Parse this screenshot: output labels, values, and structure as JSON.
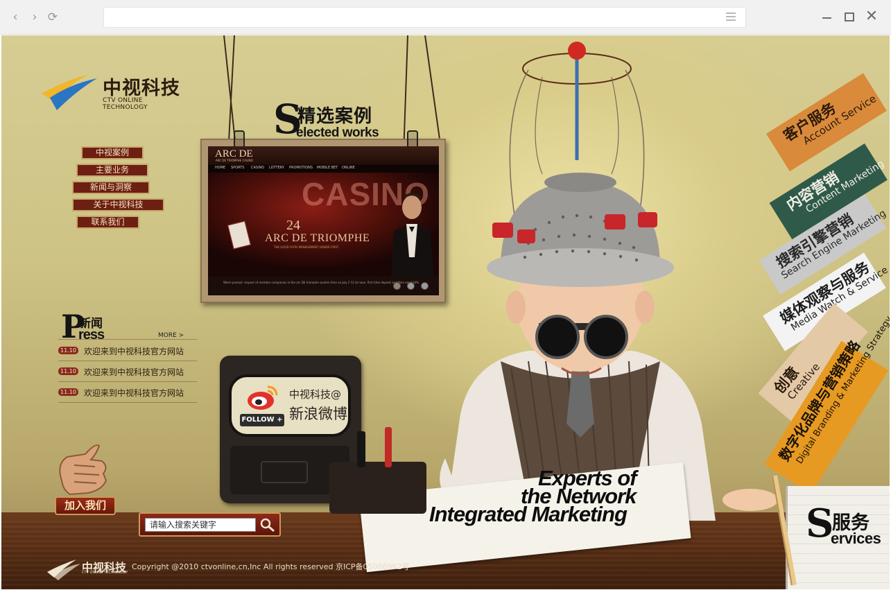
{
  "browser": {
    "back": "‹",
    "forward": "›",
    "reload": "⟳",
    "url": "",
    "close": "✕"
  },
  "logo": {
    "cn": "中视科技",
    "en": "CTV ONLINE TECHNOLOGY"
  },
  "nav": [
    {
      "label": "中视案例"
    },
    {
      "label": "主要业务"
    },
    {
      "label": "新闻与洞察"
    },
    {
      "label": "关于中视科技"
    },
    {
      "label": "联系我们"
    }
  ],
  "selected_works": {
    "initial": "S",
    "cn": "精选案例",
    "en": "elected works",
    "preview": {
      "logo": "ARC DE",
      "logo_sub": "ARC DE TRIOMPHE CASINO",
      "nav": [
        "HOME",
        "SPORTS",
        "CASINO",
        "LOTTERY",
        "PROMOTIONS",
        "MOBILE BET",
        "ONLINE"
      ],
      "banner_word": "CASINO",
      "number": "24",
      "headline": "ARC DE TRIOMPHE",
      "tagline": "THE GOOD FAITH MANAGEMENT HONOR FIRST",
      "notice": "Warm prompt: respect of member companies in the arc DE triomphe system time on July 2 12 at noon, first time deposit and then send 10%"
    }
  },
  "press": {
    "initial": "P",
    "cn": "新闻",
    "en": "ress",
    "more": "MORE >",
    "items": [
      {
        "date": "11.10",
        "title": "欢迎来到中视科技官方网站"
      },
      {
        "date": "11.10",
        "title": "欢迎来到中视科技官方网站"
      },
      {
        "date": "11.10",
        "title": "欢迎来到中视科技官方网站"
      }
    ]
  },
  "weibo": {
    "line1": "中视科技@",
    "line2": "新浪微博",
    "follow": "FOLLOW +"
  },
  "join": {
    "label": "加入我们"
  },
  "search": {
    "placeholder": "请输入搜索关键字"
  },
  "slogan": {
    "line1": "Experts of",
    "line2": "the Network",
    "line3": "Integrated Marketing"
  },
  "services_menu": [
    {
      "cn": "客户服务",
      "en": "Account Service",
      "color": "#d98a3a",
      "text": "#2a1a0c"
    },
    {
      "cn": "内容营销",
      "en": "Content Marketing",
      "color": "#2f5a4a",
      "text": "#f2efe4"
    },
    {
      "cn": "搜索引擎营销",
      "en": "Search Engine Marketing",
      "color": "#c9c9c9",
      "text": "#2a2a2a"
    },
    {
      "cn": "媒体观察与服务",
      "en": "Media Watch & Service",
      "color": "#f3f3f3",
      "text": "#1d1d1d"
    },
    {
      "cn": "创意",
      "en": "Creative",
      "color": "#e4c9a6",
      "text": "#2a1a0c"
    },
    {
      "cn": "数字化品牌与营销策略",
      "en": "Digital Branding & Marketing Strategy",
      "color": "#e79a22",
      "text": "#1a1208"
    }
  ],
  "services": {
    "initial": "S",
    "cn": "服务",
    "en": "ervices"
  },
  "footer": {
    "logo_cn": "中视科技",
    "logo_en": "CTV ONLINE TECHNOLOGY",
    "copyright": "Copyright @2010 ctvonline,cn,Inc All rights reserved  京ICP备05066962号"
  }
}
